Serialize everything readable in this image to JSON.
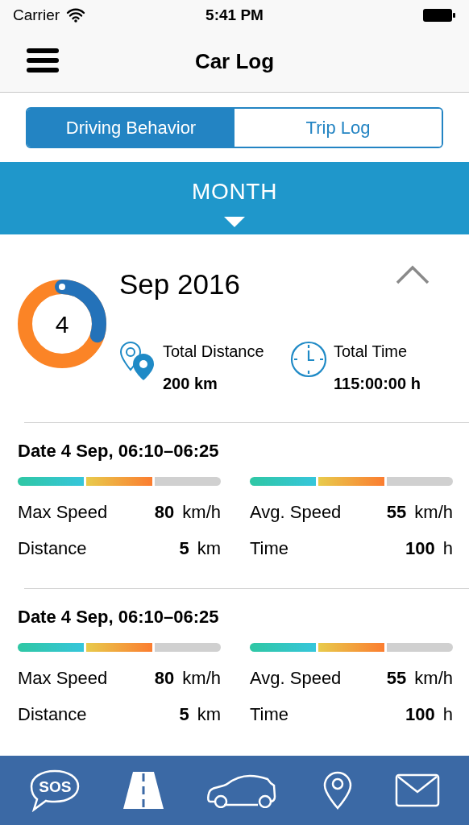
{
  "status_bar": {
    "carrier": "Carrier",
    "time": "5:41 PM"
  },
  "nav": {
    "title": "Car Log"
  },
  "segments": [
    {
      "label": "Driving Behavior",
      "selected": true
    },
    {
      "label": "Trip Log",
      "selected": false
    }
  ],
  "period": {
    "label": "MONTH"
  },
  "summary": {
    "month": "Sep 2016",
    "score": "4",
    "level": 0.3,
    "expanded": true,
    "stats": [
      {
        "kind": "distance",
        "label": "Total Distance",
        "value": "200 km"
      },
      {
        "kind": "time",
        "label": "Total Time",
        "value": "115:00:00 h"
      }
    ]
  },
  "trips": [
    {
      "title": "Date 4 Sep, 06:10–06:25",
      "left": [
        {
          "label": "Max Speed",
          "value": "80",
          "unit": "km/h"
        },
        {
          "label": "Distance",
          "value": "5",
          "unit": "km"
        }
      ],
      "right": [
        {
          "label": "Avg. Speed",
          "value": "55",
          "unit": "km/h"
        },
        {
          "label": "Time",
          "value": "100",
          "unit": "h"
        }
      ]
    },
    {
      "title": "Date 4 Sep, 06:10–06:25",
      "left": [
        {
          "label": "Max Speed",
          "value": "80",
          "unit": "km/h"
        },
        {
          "label": "Distance",
          "value": "5",
          "unit": "km"
        }
      ],
      "right": [
        {
          "label": "Avg. Speed",
          "value": "55",
          "unit": "km/h"
        },
        {
          "label": "Time",
          "value": "100",
          "unit": "h"
        }
      ]
    }
  ],
  "tab_bar": [
    {
      "kind": "sos",
      "label": "SOS"
    },
    {
      "kind": "road"
    },
    {
      "kind": "car"
    },
    {
      "kind": "pin"
    },
    {
      "kind": "mail"
    }
  ]
}
